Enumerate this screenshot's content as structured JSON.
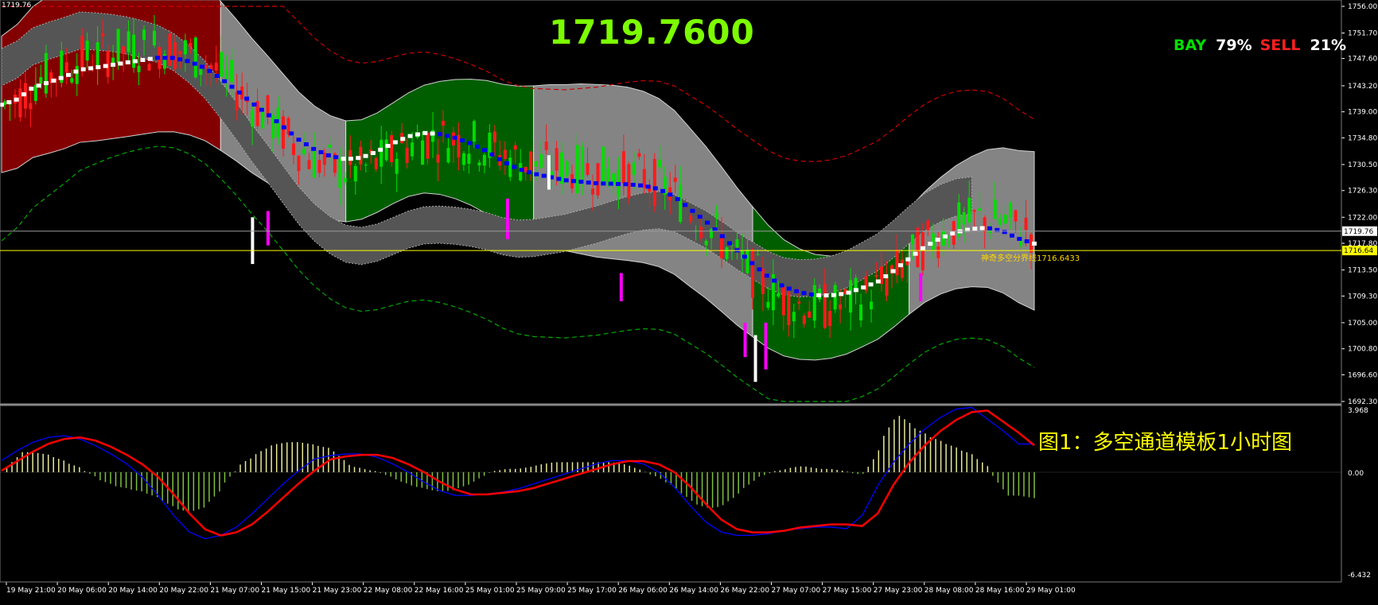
{
  "symbol": "1719.76",
  "big_price": "1719.7600",
  "sentiment": {
    "buy_label": "BAY",
    "buy_pct": "79%",
    "sell_label": "SELL",
    "sell_pct": "21%"
  },
  "divider_label": "神奇多空分界线1716.6433",
  "caption": "图1：多空通道模板1小时图",
  "colors": {
    "bg": "#000000",
    "bull": "#00dd00",
    "bear": "#ff1a1a",
    "axis": "#ffffff",
    "band_red": "#8b0000",
    "band_green": "#006400",
    "band_gray": "#8c8c8c",
    "blue_ma": "#0000ff",
    "white_ma": "#ffffff",
    "magenta": "#ff00ff",
    "divider": "#ffff00",
    "macd_red": "#ff0000",
    "macd_blue": "#0000ff"
  },
  "chart_data": [
    {
      "type": "line",
      "title": "",
      "subtype": "candlestick with channel bands",
      "ylim": [
        1692.3,
        1756.0
      ],
      "y_ticks": [
        "1756.00",
        "1751.70",
        "1747.60",
        "1743.20",
        "1739.00",
        "1734.80",
        "1730.50",
        "1726.30",
        "1722.00",
        "1717.80",
        "1713.50",
        "1709.30",
        "1705.00",
        "1700.80",
        "1696.60",
        "1692.30"
      ],
      "x_ticks": [
        "19 May 21:00",
        "20 May 06:00",
        "20 May 14:00",
        "20 May 22:00",
        "21 May 07:00",
        "21 May 15:00",
        "21 May 23:00",
        "22 May 08:00",
        "22 May 16:00",
        "25 May 01:00",
        "25 May 09:00",
        "25 May 17:00",
        "26 May 06:00",
        "26 May 14:00",
        "26 May 22:00",
        "27 May 07:00",
        "27 May 15:00",
        "27 May 23:00",
        "28 May 08:00",
        "28 May 16:00",
        "29 May 01:00"
      ],
      "current_price": 1719.76,
      "current_price_label": "1719.76",
      "divider_price": 1716.64,
      "divider_price_label": "1716.64",
      "series": [
        {
          "name": "",
          "values": [
            1740.2,
            1741.5,
            1743.8,
            1745.0,
            1746.2,
            1747.6,
            1748.1,
            1748.6,
            1749.0,
            1749.3,
            1749.5,
            1749.2,
            1748.3,
            1746.9,
            1744.8,
            1742.5,
            1740.0,
            1737.8,
            1735.4,
            1733.0,
            1731.2,
            1730.0,
            1729.4,
            1729.7,
            1730.8,
            1732.3,
            1733.7,
            1734.6,
            1734.8,
            1734.6,
            1734.1,
            1733.3,
            1732.1,
            1731.2,
            1730.7,
            1730.4,
            1730.0,
            1729.8,
            1729.5,
            1729.3,
            1729.0,
            1728.5,
            1727.6,
            1726.0,
            1723.6,
            1721.2,
            1718.5,
            1715.7,
            1713.2,
            1710.8,
            1709.0,
            1708.0,
            1707.5,
            1707.5,
            1708.0,
            1709.1,
            1710.4,
            1712.5,
            1714.9,
            1717.2,
            1719.0,
            1720.4,
            1721.3,
            1721.8,
            1721.5,
            1720.5,
            1719.8
          ]
        }
      ]
    },
    {
      "type": "bar",
      "title": "",
      "subtype": "MACD oscillator",
      "ylim": [
        -6.432,
        3.968
      ],
      "y_ticks": [
        "3.968",
        "0.00",
        "-6.432"
      ],
      "series": [
        {
          "name": "",
          "values": [
            0.1,
            0.7,
            1.3,
            1.8,
            2.1,
            2.2,
            2.0,
            1.6,
            1.1,
            0.5,
            -0.3,
            -1.4,
            -2.6,
            -3.6,
            -4.0,
            -3.8,
            -3.3,
            -2.5,
            -1.6,
            -0.7,
            0.1,
            0.8,
            1.0,
            1.1,
            1.1,
            0.9,
            0.5,
            0.0,
            -0.6,
            -1.1,
            -1.4,
            -1.4,
            -1.3,
            -1.2,
            -1.0,
            -0.7,
            -0.4,
            -0.1,
            0.2,
            0.5,
            0.7,
            0.7,
            0.5,
            0.0,
            -0.9,
            -2.0,
            -3.0,
            -3.6,
            -3.8,
            -3.8,
            -3.7,
            -3.5,
            -3.4,
            -3.3,
            -3.3,
            -3.4,
            -2.6,
            -0.8,
            0.6,
            1.7,
            2.6,
            3.3,
            3.8,
            3.9,
            3.2,
            2.5,
            1.7
          ]
        }
      ]
    }
  ]
}
